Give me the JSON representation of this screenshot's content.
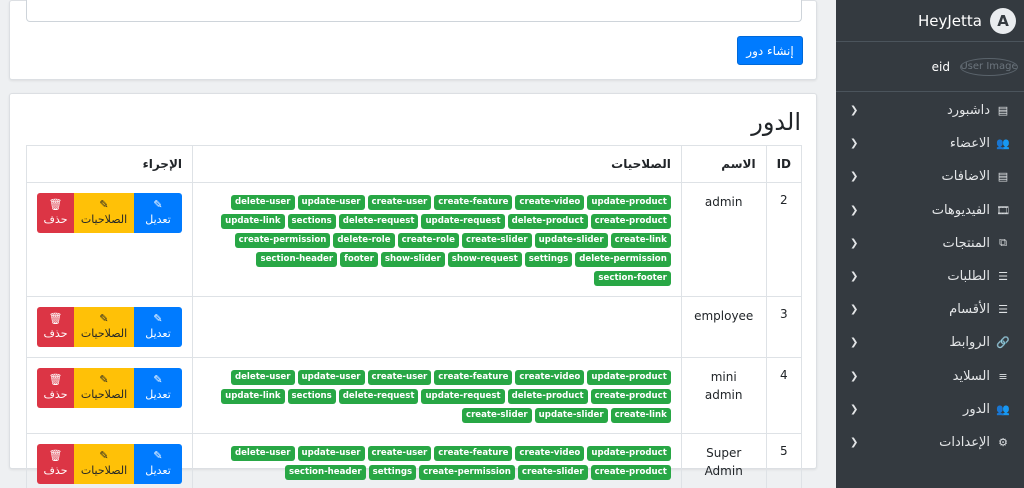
{
  "brand": {
    "name": "HeyJetta",
    "logo_letter": "A"
  },
  "user": {
    "name": "eid",
    "image_alt": "User Image"
  },
  "nav": [
    {
      "label": "داشبورد",
      "icon": "clipboard-icon",
      "glyph": "▤"
    },
    {
      "label": "الاعضاء",
      "icon": "users-icon",
      "glyph": "👥"
    },
    {
      "label": "الاضافات",
      "icon": "clipboard-icon",
      "glyph": "▤"
    },
    {
      "label": "الفيديوهات",
      "icon": "film-icon",
      "glyph": "🎞"
    },
    {
      "label": "المنتجات",
      "icon": "boxes-icon",
      "glyph": "⧉"
    },
    {
      "label": "الطلبات",
      "icon": "tasks-icon",
      "glyph": "☰"
    },
    {
      "label": "الأقسام",
      "icon": "tasks-icon",
      "glyph": "☰"
    },
    {
      "label": "الروابط",
      "icon": "link-icon",
      "glyph": "🔗"
    },
    {
      "label": "السلايد",
      "icon": "sliders-icon",
      "glyph": "≡"
    },
    {
      "label": "الدور",
      "icon": "users-icon",
      "glyph": "👥"
    },
    {
      "label": "الإعدادات",
      "icon": "gears-icon",
      "glyph": "⚙"
    }
  ],
  "create_button": "إنشاء دور",
  "page_title": "الدور",
  "table": {
    "headers": {
      "id": "ID",
      "name": "الاسم",
      "permissions": "الصلاحيات",
      "actions": "الإجراء"
    },
    "actions": {
      "edit": "تعديل",
      "permissions": "الصلاحيات",
      "delete": "حذف"
    },
    "rows": [
      {
        "id": "2",
        "name": "admin",
        "permissions": [
          "update-product",
          "create-video",
          "create-feature",
          "create-user",
          "update-user",
          "delete-user",
          "create-product",
          "delete-product",
          "update-request",
          "delete-request",
          "sections",
          "update-link",
          "create-link",
          "update-slider",
          "create-slider",
          "create-role",
          "delete-role",
          "create-permission",
          "delete-permission",
          "settings",
          "show-request",
          "show-slider",
          "footer",
          "section-header",
          "section-footer"
        ]
      },
      {
        "id": "3",
        "name": "employee",
        "permissions": []
      },
      {
        "id": "4",
        "name": "mini admin",
        "permissions": [
          "update-product",
          "create-video",
          "create-feature",
          "create-user",
          "update-user",
          "delete-user",
          "create-product",
          "delete-product",
          "update-request",
          "delete-request",
          "sections",
          "update-link",
          "create-link",
          "update-slider",
          "create-slider"
        ]
      },
      {
        "id": "5",
        "name": "Super Admin",
        "permissions": [
          "update-product",
          "create-video",
          "create-feature",
          "create-user",
          "update-user",
          "delete-user",
          "create-product",
          "create-slider",
          "create-permission",
          "settings",
          "section-header"
        ]
      }
    ]
  }
}
